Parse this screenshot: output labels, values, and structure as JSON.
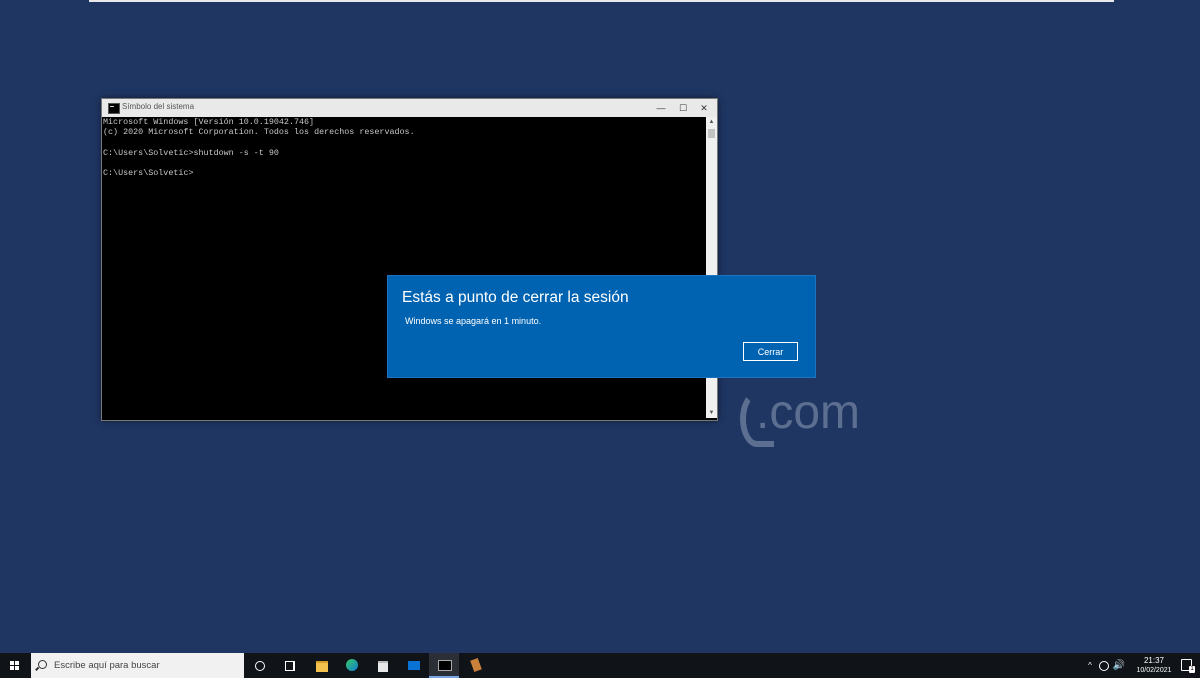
{
  "desktop": {
    "watermark_text": ".com"
  },
  "cmd_window": {
    "title": "Símbolo del sistema",
    "lines": [
      "Microsoft Windows [Versión 10.0.19042.746]",
      "(c) 2020 Microsoft Corporation. Todos los derechos reservados.",
      "",
      "C:\\Users\\Solvetic>shutdown -s -t 90",
      "",
      "C:\\Users\\Solvetic>"
    ],
    "controls": {
      "minimize": "—",
      "maximize": "☐",
      "close": "✕"
    }
  },
  "dialog": {
    "title": "Estás a punto de cerrar la sesión",
    "message": "Windows se apagará en 1 minuto.",
    "button_label": "Cerrar",
    "accent_color": "#0063b1"
  },
  "taskbar": {
    "search_placeholder": "Escribe aquí para buscar",
    "pinned_icons": [
      "cortana-icon",
      "task-view-icon",
      "file-explorer-icon",
      "edge-icon",
      "store-icon",
      "mail-icon",
      "command-prompt-icon",
      "tool-icon"
    ],
    "tray": {
      "chevron": "^",
      "volume": "🔊",
      "time": "21:37",
      "date": "10/02/2021",
      "notification_count": "1"
    }
  }
}
